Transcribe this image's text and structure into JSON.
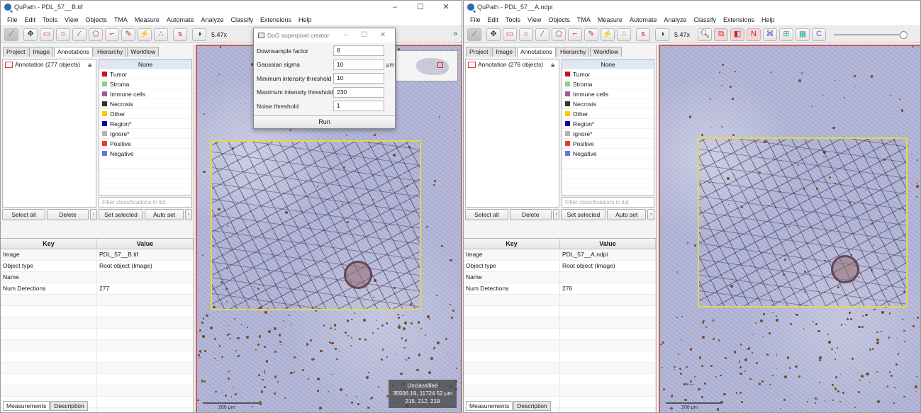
{
  "windowA": {
    "title": "QuPath - PDL_57__B.tif",
    "menu": [
      "File",
      "Edit",
      "Tools",
      "View",
      "Objects",
      "TMA",
      "Measure",
      "Automate",
      "Analyze",
      "Classify",
      "Extensions",
      "Help"
    ],
    "zoom": "5.47x",
    "tabs": [
      "Project",
      "Image",
      "Annotations",
      "Hierarchy",
      "Workflow"
    ],
    "annotation_item": "Annotation (277 objects)",
    "classes": [
      {
        "name": "None",
        "color": ""
      },
      {
        "name": "Tumor",
        "color": "#c8141e"
      },
      {
        "name": "Stroma",
        "color": "#96c896"
      },
      {
        "name": "Immune cells",
        "color": "#a05aa0"
      },
      {
        "name": "Necrosis",
        "color": "#323232"
      },
      {
        "name": "Other",
        "color": "#ffc800"
      },
      {
        "name": "Region*",
        "color": "#0000b4"
      },
      {
        "name": "Ignore*",
        "color": "#b4b4b4"
      },
      {
        "name": "Positive",
        "color": "#e63c3c"
      },
      {
        "name": "Negative",
        "color": "#7070e0"
      }
    ],
    "filter_placeholder": "Filter classifications in list",
    "buttons": {
      "select_all": "Select all",
      "delete": "Delete",
      "set_selected": "Set selected",
      "auto_set": "Auto set"
    },
    "table": {
      "headers": [
        "Key",
        "Value"
      ],
      "rows": [
        [
          "Image",
          "PDL_57__B.tif"
        ],
        [
          "Object type",
          "Root object (Image)"
        ],
        [
          "Name",
          ""
        ],
        [
          "Num Detections",
          "277"
        ]
      ]
    },
    "bottom_tabs": [
      "Measurements",
      "Description"
    ],
    "info": {
      "cls": "Unclassified",
      "coords": "35506.19, 11724.52 μm",
      "rgb": "215, 212, 219"
    },
    "scale_label": "200 μm"
  },
  "dialog": {
    "title": "DoG superpixel creator",
    "fields": [
      {
        "label": "Downsample factor",
        "value": "8",
        "unit": ""
      },
      {
        "label": "Gaussian sigma",
        "value": "10",
        "unit": "μm"
      },
      {
        "label": "Minimum intensity threshold",
        "value": "10",
        "unit": ""
      },
      {
        "label": "Maximum intensity threshold",
        "value": "230",
        "unit": ""
      },
      {
        "label": "Noise threshold",
        "value": "1",
        "unit": ""
      }
    ],
    "run": "Run"
  },
  "windowB": {
    "title": "QuPath - PDL_57__A.ndpi",
    "menu": [
      "File",
      "Edit",
      "Tools",
      "View",
      "Objects",
      "TMA",
      "Measure",
      "Automate",
      "Analyze",
      "Classify",
      "Extensions",
      "Help"
    ],
    "zoom": "5.47x",
    "tabs": [
      "Project",
      "Image",
      "Annotations",
      "Hierarchy",
      "Workflow"
    ],
    "annotation_item": "Annotation (276 objects)",
    "filter_placeholder": "Filter classifications in list",
    "buttons": {
      "select_all": "Select all",
      "delete": "Delete",
      "set_selected": "Set selected",
      "auto_set": "Auto set"
    },
    "table": {
      "headers": [
        "Key",
        "Value"
      ],
      "rows": [
        [
          "Image",
          "PDL_57__A.ndpi"
        ],
        [
          "Object type",
          "Root object (Image)"
        ],
        [
          "Name",
          ""
        ],
        [
          "Num Detections",
          "276"
        ]
      ]
    },
    "bottom_tabs": [
      "Measurements",
      "Description"
    ],
    "scale_label": "200 μm"
  },
  "window_controls": [
    "–",
    "☐",
    "✕"
  ]
}
